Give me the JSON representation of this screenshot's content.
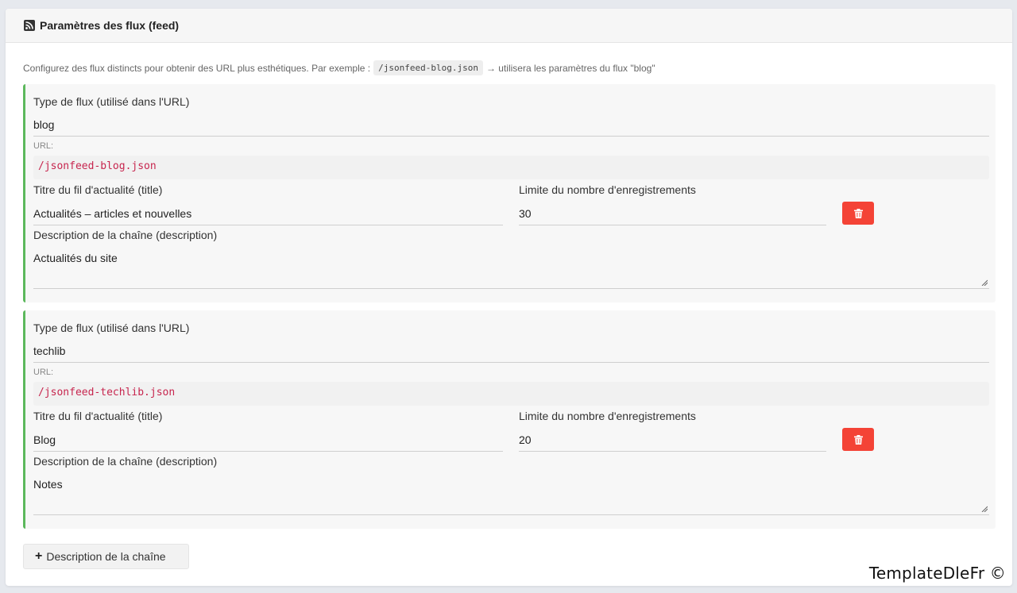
{
  "header": {
    "icon": "rss-icon",
    "title": "Paramètres des flux (feed)"
  },
  "intro": {
    "text_before": "Configurez des flux distincts pour obtenir des URL plus esthétiques. Par exemple :",
    "code": "/jsonfeed-blog.json",
    "text_after": "→ utilisera les paramètres du flux \"blog\""
  },
  "labels": {
    "type": "Type de flux (utilisé dans l'URL)",
    "url": "URL:",
    "title": "Titre du fil d'actualité (title)",
    "limit": "Limite du nombre d'enregistrements",
    "description": "Description de la chaîne (description)"
  },
  "feeds": [
    {
      "type": "blog",
      "url": "/jsonfeed-blog.json",
      "title": "Actualités – articles et nouvelles",
      "limit": "30",
      "description": "Actualités du site"
    },
    {
      "type": "techlib",
      "url": "/jsonfeed-techlib.json",
      "title": "Blog",
      "limit": "20",
      "description": "Notes"
    }
  ],
  "add_button": {
    "icon": "plus-icon",
    "label": "Description de la chaîne"
  },
  "delete_icon": "trash-icon",
  "colors": {
    "accent_border": "#5cb85c",
    "delete": "#f44336",
    "code": "#c7254e"
  },
  "watermark": "TemplateDleFr ©"
}
